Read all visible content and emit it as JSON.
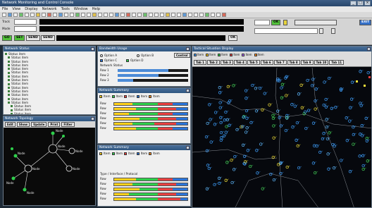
{
  "window": {
    "title": "Network Monitoring and Control Console",
    "controls": [
      "_",
      "□",
      "×"
    ]
  },
  "menu": [
    "File",
    "View",
    "Display",
    "Network",
    "Tools",
    "Window",
    "Help"
  ],
  "controls": {
    "track_label": "Track",
    "track_value": "",
    "mode_label": "Mode",
    "mode_value": "",
    "status_strip": "",
    "buttons": {
      "go": "GO",
      "set": "SET",
      "send": "SEND",
      "send2": "SEND",
      "ok": "OK",
      "ok2": "OK",
      "exit": "EXIT"
    },
    "network_select": "",
    "data_field": ""
  },
  "panels": {
    "tree": {
      "title": "Network Status",
      "items": [
        {
          "label": "Status item",
          "level": 0
        },
        {
          "label": "Status item",
          "level": 1
        },
        {
          "label": "Status item",
          "level": 1
        },
        {
          "label": "Status item",
          "level": 1
        },
        {
          "label": "Status item",
          "level": 1
        },
        {
          "label": "Status item",
          "level": 1
        },
        {
          "label": "Status item",
          "level": 1
        },
        {
          "label": "Status item",
          "level": 1
        },
        {
          "label": "Status item",
          "level": 1
        },
        {
          "label": "Status item",
          "level": 1
        },
        {
          "label": "Status item",
          "level": 1
        },
        {
          "label": "Status item",
          "level": 1
        },
        {
          "label": "Status item",
          "level": 1
        },
        {
          "label": "Status item",
          "level": 1
        },
        {
          "label": "Status item",
          "level": 2
        },
        {
          "label": "Status item",
          "level": 2
        },
        {
          "label": "Status item",
          "level": 2
        },
        {
          "label": "Status item",
          "level": 2
        },
        {
          "label": "Status item",
          "level": 2
        },
        {
          "label": "Status item",
          "level": 2
        }
      ]
    },
    "topology": {
      "title": "Network Topology",
      "buttons": [
        "Edit",
        "Show",
        "Update",
        "Print",
        "Filter"
      ],
      "nodes": [
        {
          "id": "A",
          "label": "Node"
        },
        {
          "id": "B",
          "label": "Node"
        },
        {
          "id": "C",
          "label": "Node"
        },
        {
          "id": "D",
          "label": "Node"
        },
        {
          "id": "E",
          "label": "Node"
        },
        {
          "id": "F",
          "label": "Node"
        },
        {
          "id": "G",
          "label": "Node"
        },
        {
          "id": "H",
          "label": "Node"
        }
      ]
    },
    "bandwidth": {
      "title": "Bandwidth Usage",
      "radio1": "Option A",
      "radio2": "Option B",
      "radio3": "Option C",
      "radio4": "Option D",
      "button": "Control",
      "subtitle": "Network Status",
      "rows": [
        {
          "label": "Row 1",
          "value": 0.72
        },
        {
          "label": "Row 2",
          "value": 0.58
        },
        {
          "label": "Row 3",
          "value": 0.22
        }
      ]
    },
    "summary1": {
      "title": "Network Summary",
      "legend": [
        {
          "label": "Item",
          "color": "#ffd11a"
        },
        {
          "label": "Item",
          "color": "#2ecf4b"
        },
        {
          "label": "Item",
          "color": "#e84040"
        },
        {
          "label": "Item",
          "color": "#2a74d9"
        },
        {
          "label": "Item",
          "color": "#ff8c1a"
        }
      ],
      "rows": [
        {
          "label": "Row",
          "segments": [
            0.25,
            0.35,
            0.2,
            0.2
          ]
        },
        {
          "label": "Row",
          "segments": [
            0.3,
            0.3,
            0.25,
            0.15
          ]
        },
        {
          "label": "Row",
          "segments": [
            0.2,
            0.4,
            0.2,
            0.2
          ]
        },
        {
          "label": "Row",
          "segments": [
            0.35,
            0.25,
            0.25,
            0.15
          ]
        },
        {
          "label": "Row",
          "segments": [
            0.25,
            0.3,
            0.3,
            0.15
          ]
        },
        {
          "label": "Row",
          "segments": [
            0.3,
            0.3,
            0.2,
            0.2
          ]
        }
      ]
    },
    "summary2": {
      "title": "Network Summary",
      "legend": [
        {
          "label": "Item",
          "color": "#ffd11a"
        },
        {
          "label": "Item",
          "color": "#2ecf4b"
        },
        {
          "label": "Item",
          "color": "#e84040"
        },
        {
          "label": "Item",
          "color": "#2a74d9"
        },
        {
          "label": "Item",
          "color": "#ff8c1a"
        }
      ],
      "header_row": "Type / Interface / Protocol",
      "rows": [
        {
          "label": "Row",
          "segments": [
            0.3,
            0.3,
            0.2,
            0.2
          ]
        },
        {
          "label": "Row",
          "segments": [
            0.25,
            0.35,
            0.25,
            0.15
          ]
        },
        {
          "label": "Row",
          "segments": [
            0.35,
            0.25,
            0.2,
            0.2
          ]
        },
        {
          "label": "Row",
          "segments": [
            0.2,
            0.4,
            0.25,
            0.15
          ]
        },
        {
          "label": "Row",
          "segments": [
            0.3,
            0.3,
            0.3,
            0.1
          ]
        }
      ]
    },
    "map": {
      "title": "Tactical Situation Display",
      "legend": [
        {
          "label": "Item",
          "color": "#3fa1ff"
        },
        {
          "label": "Item",
          "color": "#ffd11a"
        },
        {
          "label": "Item",
          "color": "#2ecf4b"
        },
        {
          "label": "Item",
          "color": "#e84040"
        },
        {
          "label": "Item",
          "color": "#b26bff"
        },
        {
          "label": "Item",
          "color": "#ff8c1a"
        }
      ],
      "tabs": [
        "Tab 1",
        "Tab 2",
        "Tab 3",
        "Tab 4",
        "Tab 5",
        "Tab 6",
        "Tab 7",
        "Tab 8",
        "Tab 9",
        "Tab 10",
        "Tab 11"
      ]
    }
  },
  "colors": {
    "accent": "#2f5680",
    "map_bg": "#06080d",
    "track_blue": "#3fa1ff",
    "track_yellow": "#f5e33a",
    "track_green": "#45d65a"
  }
}
